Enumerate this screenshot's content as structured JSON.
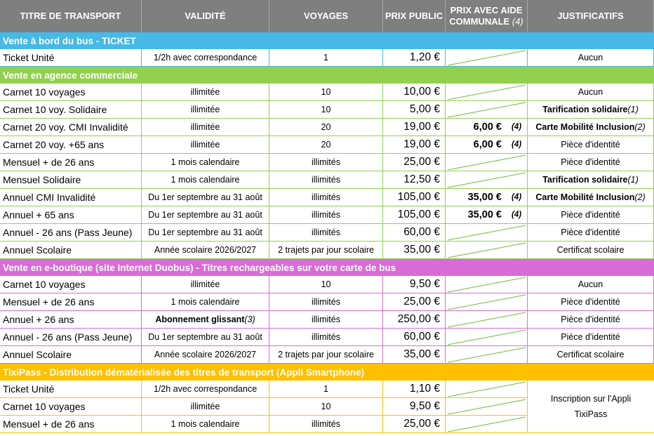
{
  "colors": {
    "header_bg": "#7f7f7f",
    "bus": "#46b9e6",
    "agence": "#92d050",
    "eboutique": "#d96bd6",
    "tixipass": "#ffc000",
    "slash": "#6fbd3c"
  },
  "headers": [
    {
      "text": "TITRE DE TRANSPORT"
    },
    {
      "text": "VALIDITÉ"
    },
    {
      "text": "VOYAGES"
    },
    {
      "text": "PRIX PUBLIC"
    },
    {
      "text": "PRIX AVEC AIDE COMMUNALE ",
      "note": "(4)"
    },
    {
      "text": "JUSTIFICATIFS"
    }
  ],
  "sections": [
    {
      "title": "Vente à bord du bus - TICKET",
      "color": "bus",
      "rows": [
        {
          "title": "Ticket Unité",
          "validity": "1/2h avec correspondance",
          "trips": "1",
          "price": "1,20 €",
          "aid": "",
          "aid_note": "",
          "doc": "Aucun"
        }
      ]
    },
    {
      "title": "Vente en agence commerciale",
      "color": "agence",
      "rows": [
        {
          "title": "Carnet 10 voyages",
          "validity": "illimitée",
          "trips": "10",
          "price": "10,00 €",
          "aid": "",
          "aid_note": "",
          "doc": "Aucun"
        },
        {
          "title": "Carnet 10 voy. Solidaire",
          "validity": "illimitée",
          "trips": "10",
          "price": "5,00 €",
          "aid": "",
          "aid_note": "",
          "doc": "Tarification solidaire ",
          "doc_note": "(1)"
        },
        {
          "title": "Carnet 20 voy. CMI Invalidité",
          "validity": "illimitée",
          "trips": "20",
          "price": "19,00 €",
          "aid": "6,00 €",
          "aid_note": "(4)",
          "doc": "Carte Mobilité Inclusion ",
          "doc_note": "(2)"
        },
        {
          "title": "Carnet 20 voy. +65 ans",
          "validity": "illimitée",
          "trips": "20",
          "price": "19,00 €",
          "aid": "6,00 €",
          "aid_note": "(4)",
          "doc": "Pièce d'identité"
        },
        {
          "title": "Mensuel + de 26 ans",
          "validity": "1 mois calendaire",
          "trips": "illimités",
          "price": "25,00 €",
          "aid": "",
          "aid_note": "",
          "doc": "Pièce d'identité"
        },
        {
          "title": "Mensuel Solidaire",
          "validity": "1 mois calendaire",
          "trips": "illimités",
          "price": "12,50 €",
          "aid": "",
          "aid_note": "",
          "doc": "Tarification solidaire ",
          "doc_note": "(1)"
        },
        {
          "title": "Annuel CMI Invalidité",
          "validity": "Du 1er septembre au 31 août",
          "trips": "illimités",
          "price": "105,00 €",
          "aid": "35,00 €",
          "aid_note": "(4)",
          "doc": "Carte Mobilité Inclusion ",
          "doc_note": "(2)"
        },
        {
          "title": "Annuel + 65 ans",
          "validity": "Du 1er septembre au 31 août",
          "trips": "illimités",
          "price": "105,00 €",
          "aid": "35,00 €",
          "aid_note": "(4)",
          "doc": "Pièce d'identité"
        },
        {
          "title": "Annuel - 26 ans (Pass Jeune)",
          "validity": "Du 1er septembre au 31 août",
          "trips": "illimités",
          "price": "60,00 €",
          "aid": "",
          "aid_note": "",
          "doc": "Pièce d'identité"
        },
        {
          "title": "Annuel Scolaire",
          "validity": "Année scolaire 2026/2027",
          "trips": "2 trajets par jour scolaire",
          "price": "35,00 €",
          "aid": "",
          "aid_note": "",
          "doc": "Certificat scolaire"
        }
      ]
    },
    {
      "title": "Vente en e-boutique (site Internet Duobus) - Titres rechargeables sur votre carte de bus",
      "color": "eboutique",
      "rows": [
        {
          "title": "Carnet 10 voyages",
          "validity": "illimitée",
          "trips": "10",
          "price": "9,50 €",
          "aid": "",
          "aid_note": "",
          "doc": "Aucun"
        },
        {
          "title": "Mensuel + de 26 ans",
          "validity": "1 mois calendaire",
          "trips": "illimités",
          "price": "25,00 €",
          "aid": "",
          "aid_note": "",
          "doc": "Pièce d'identité"
        },
        {
          "title": "Annuel + 26 ans",
          "validity": "Abonnement glissant ",
          "validity_note": "(3)",
          "trips": "illimités",
          "price": "250,00 €",
          "aid": "",
          "aid_note": "",
          "doc": "Pièce d'identité"
        },
        {
          "title": "Annuel - 26 ans (Pass Jeune)",
          "validity": "Du 1er septembre au 31 août",
          "trips": "illimités",
          "price": "60,00 €",
          "aid": "",
          "aid_note": "",
          "doc": "Pièce d'identité"
        },
        {
          "title": "Annuel Scolaire",
          "validity": "Année scolaire 2026/2027",
          "trips": "2 trajets par jour scolaire",
          "price": "35,00 €",
          "aid": "",
          "aid_note": "",
          "doc": "Certificat scolaire"
        }
      ]
    },
    {
      "title": "TixiPass - Distribution dématérialisée des titres de transport (Appli Smartphone)",
      "color": "tixipass",
      "merged_doc": "Inscription sur l'Appli TixiPass",
      "rows": [
        {
          "title": "Ticket Unité",
          "validity": "1/2h avec correspondance",
          "trips": "1",
          "price": "1,10 €",
          "aid": "",
          "aid_note": ""
        },
        {
          "title": "Carnet 10 voyages",
          "validity": "illimitée",
          "trips": "10",
          "price": "9,50 €",
          "aid": "",
          "aid_note": ""
        },
        {
          "title": "Mensuel + de 26 ans",
          "validity": "1 mois calendaire",
          "trips": "illimités",
          "price": "25,00 €",
          "aid": "",
          "aid_note": ""
        }
      ]
    }
  ]
}
